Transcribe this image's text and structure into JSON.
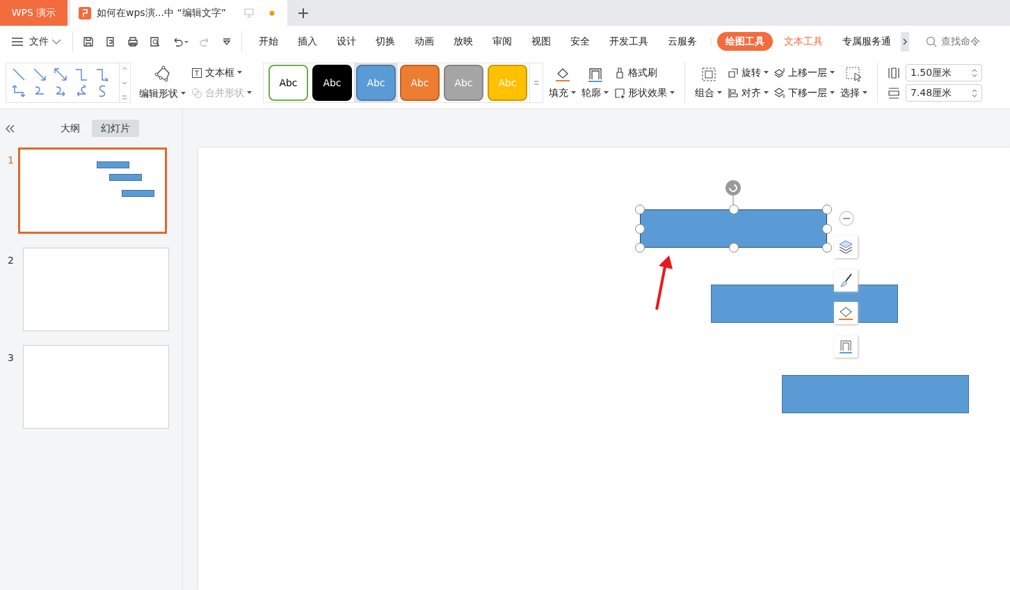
{
  "app_tab": "WPS 演示",
  "doc_tab": {
    "title": "如何在wps演...中 “编辑文字”",
    "unsaved": true
  },
  "menu": {
    "file": "文件",
    "tabs": [
      {
        "label": "开始",
        "kind": "plain",
        "selected": false
      },
      {
        "label": "插入",
        "kind": "plain",
        "selected": false
      },
      {
        "label": "设计",
        "kind": "plain",
        "selected": false
      },
      {
        "label": "切换",
        "kind": "plain",
        "selected": false
      },
      {
        "label": "动画",
        "kind": "plain",
        "selected": false
      },
      {
        "label": "放映",
        "kind": "plain",
        "selected": false
      },
      {
        "label": "审阅",
        "kind": "plain",
        "selected": false
      },
      {
        "label": "视图",
        "kind": "plain",
        "selected": false
      },
      {
        "label": "安全",
        "kind": "plain",
        "selected": false
      },
      {
        "label": "开发工具",
        "kind": "plain",
        "selected": false
      },
      {
        "label": "云服务",
        "kind": "plain",
        "selected": false
      },
      {
        "label": "绘图工具",
        "kind": "contextual",
        "selected": true
      },
      {
        "label": "文本工具",
        "kind": "contextual",
        "selected": false
      },
      {
        "label": "专属服务通",
        "kind": "plain",
        "selected": false
      }
    ],
    "search": {
      "placeholder": "查找命令"
    }
  },
  "ribbon": {
    "edit_shape": "编辑形状",
    "text_box": "文本框",
    "merge_shape": {
      "label": "合并形状",
      "disabled": true
    },
    "styles": [
      {
        "label": "Abc",
        "color": "#ffffff",
        "selected": false
      },
      {
        "label": "Abc",
        "color": "#000000",
        "selected": false
      },
      {
        "label": "Abc",
        "color": "#5b9bd5",
        "selected": true
      },
      {
        "label": "Abc",
        "color": "#ed7d31",
        "selected": false
      },
      {
        "label": "Abc",
        "color": "#a5a5a5",
        "selected": false
      },
      {
        "label": "Abc",
        "color": "#ffc000",
        "selected": false
      }
    ],
    "fill": "填充",
    "outline": "轮廓",
    "format_painter": "格式刷",
    "shape_effects": "形状效果",
    "group": "组合",
    "rotate": "旋转",
    "align": "对齐",
    "bring_forward": "上移一层",
    "send_backward": "下移一层",
    "select": "选择",
    "height": "1.50厘米",
    "width": "7.48厘米"
  },
  "pane": {
    "tabs": [
      {
        "label": "大纲",
        "selected": false
      },
      {
        "label": "幻灯片",
        "selected": true
      }
    ],
    "slides": [
      {
        "number": "1",
        "selected": true
      },
      {
        "number": "2",
        "selected": false
      },
      {
        "number": "3",
        "selected": false
      }
    ]
  },
  "canvas": {
    "shapes": [
      {
        "selected": true
      },
      {
        "selected": false
      },
      {
        "selected": false
      }
    ]
  }
}
